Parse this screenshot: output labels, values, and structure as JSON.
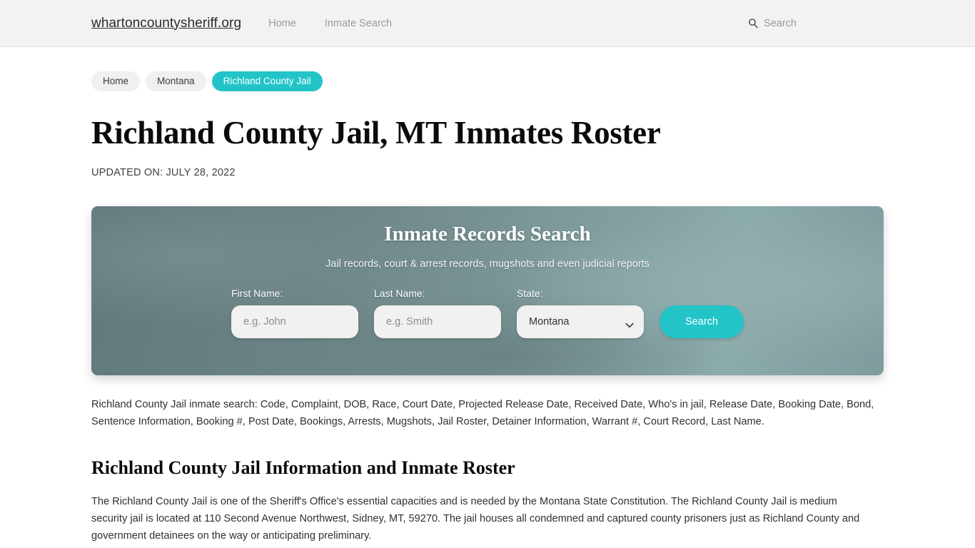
{
  "header": {
    "brand": "whartoncountysheriff.org",
    "nav": [
      {
        "label": "Home"
      },
      {
        "label": "Inmate Search"
      }
    ],
    "search_label": "Search"
  },
  "breadcrumbs": [
    {
      "label": "Home",
      "active": false
    },
    {
      "label": "Montana",
      "active": false
    },
    {
      "label": "Richland County Jail",
      "active": true
    }
  ],
  "main": {
    "title": "Richland County Jail, MT Inmates Roster",
    "updated": "UPDATED ON: JULY 28, 2022",
    "keywords": "Richland County Jail inmate search: Code, Complaint, DOB, Race, Court Date, Projected Release Date, Received Date, Who's in jail, Release Date, Booking Date, Bond, Sentence Information, Booking #, Post Date, Bookings, Arrests, Mugshots, Jail Roster, Detainer Information, Warrant #, Court Record, Last Name.",
    "section_title": "Richland County Jail Information and Inmate Roster",
    "body": "The Richland County Jail is one of the Sheriff's Office's essential capacities and is needed by the Montana State Constitution. The Richland County Jail is medium security jail is located at 110 Second Avenue Northwest, Sidney, MT, 59270. The jail houses all condemned and captured county prisoners just as Richland County and government detainees on the way or anticipating preliminary."
  },
  "search_card": {
    "title": "Inmate Records Search",
    "subtitle": "Jail records, court & arrest records, mugshots and even judicial reports",
    "first_name": {
      "label": "First Name:",
      "placeholder": "e.g. John",
      "value": ""
    },
    "last_name": {
      "label": "Last Name:",
      "placeholder": "e.g. Smith",
      "value": ""
    },
    "state": {
      "label": "State:",
      "selected": "Montana"
    },
    "submit_label": "Search"
  },
  "colors": {
    "accent_teal": "#22c4c8",
    "card_dark": "#62797c",
    "card_light": "#8cabab"
  }
}
